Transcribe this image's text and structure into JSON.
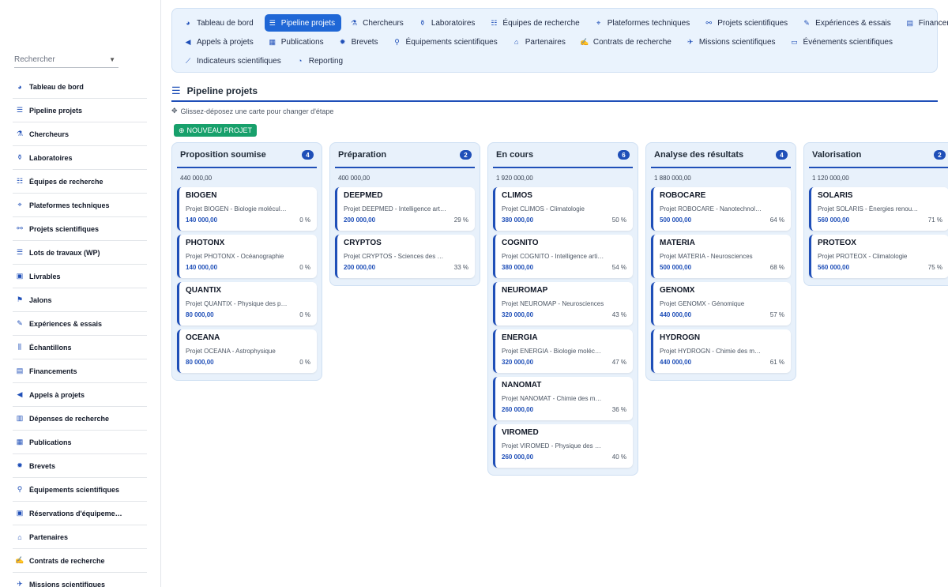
{
  "search": {
    "placeholder": "Rechercher"
  },
  "sidebar": {
    "items": [
      {
        "label": "Tableau de bord",
        "icon": "dashboard-icon",
        "glyph": "◕"
      },
      {
        "label": "Pipeline projets",
        "icon": "list-icon",
        "glyph": "☰"
      },
      {
        "label": "Chercheurs",
        "icon": "researcher-icon",
        "glyph": "⚗"
      },
      {
        "label": "Laboratoires",
        "icon": "flask-icon",
        "glyph": "⚱"
      },
      {
        "label": "Équipes de recherche",
        "icon": "users-icon",
        "glyph": "☷"
      },
      {
        "label": "Plateformes techniques",
        "icon": "satellite-icon",
        "glyph": "⌖"
      },
      {
        "label": "Projets scientifiques",
        "icon": "project-diagram-icon",
        "glyph": "⚯"
      },
      {
        "label": "Lots de travaux (WP)",
        "icon": "tasks-icon",
        "glyph": "☰"
      },
      {
        "label": "Livrables",
        "icon": "clipboard-check-icon",
        "glyph": "▣"
      },
      {
        "label": "Jalons",
        "icon": "flag-icon",
        "glyph": "⚑"
      },
      {
        "label": "Expériences & essais",
        "icon": "syringe-icon",
        "glyph": "✎"
      },
      {
        "label": "Échantillons",
        "icon": "vials-icon",
        "glyph": "⫼"
      },
      {
        "label": "Financements",
        "icon": "money-icon",
        "glyph": "▤"
      },
      {
        "label": "Appels à projets",
        "icon": "bullhorn-icon",
        "glyph": "◀"
      },
      {
        "label": "Dépenses de recherche",
        "icon": "receipt-icon",
        "glyph": "▥"
      },
      {
        "label": "Publications",
        "icon": "book-icon",
        "glyph": "▦"
      },
      {
        "label": "Brevets",
        "icon": "certificate-icon",
        "glyph": "✹"
      },
      {
        "label": "Équipements scientifiques",
        "icon": "microscope-icon",
        "glyph": "⚲"
      },
      {
        "label": "Réservations d'équipeme…",
        "icon": "calendar-check-icon",
        "glyph": "▣"
      },
      {
        "label": "Partenaires",
        "icon": "building-icon",
        "glyph": "⌂"
      },
      {
        "label": "Contrats de recherche",
        "icon": "file-contract-icon",
        "glyph": "✍"
      },
      {
        "label": "Missions scientifiques",
        "icon": "plane-icon",
        "glyph": "✈"
      }
    ]
  },
  "topnav": {
    "rows": [
      [
        {
          "label": "Tableau de bord",
          "icon": "dashboard-icon",
          "glyph": "◕",
          "active": false
        },
        {
          "label": "Pipeline projets",
          "icon": "list-icon",
          "glyph": "☰",
          "active": true
        },
        {
          "label": "Chercheurs",
          "icon": "researcher-icon",
          "glyph": "⚗",
          "active": false
        },
        {
          "label": "Laboratoires",
          "icon": "flask-icon",
          "glyph": "⚱",
          "active": false
        },
        {
          "label": "Équipes de recherche",
          "icon": "users-icon",
          "glyph": "☷",
          "active": false
        },
        {
          "label": "Plateformes techniques",
          "icon": "satellite-icon",
          "glyph": "⌖",
          "active": false
        },
        {
          "label": "Projets scientifiques",
          "icon": "project-diagram-icon",
          "glyph": "⚯",
          "active": false
        },
        {
          "label": "Expériences & essais",
          "icon": "syringe-icon",
          "glyph": "✎",
          "active": false
        },
        {
          "label": "Financements",
          "icon": "money-icon",
          "glyph": "▤",
          "active": false
        }
      ],
      [
        {
          "label": "Appels à projets",
          "icon": "bullhorn-icon",
          "glyph": "◀",
          "active": false
        },
        {
          "label": "Publications",
          "icon": "book-icon",
          "glyph": "▦",
          "active": false
        },
        {
          "label": "Brevets",
          "icon": "certificate-icon",
          "glyph": "✹",
          "active": false
        },
        {
          "label": "Équipements scientifiques",
          "icon": "microscope-icon",
          "glyph": "⚲",
          "active": false
        },
        {
          "label": "Partenaires",
          "icon": "building-icon",
          "glyph": "⌂",
          "active": false
        },
        {
          "label": "Contrats de recherche",
          "icon": "file-contract-icon",
          "glyph": "✍",
          "active": false
        },
        {
          "label": "Missions scientifiques",
          "icon": "plane-icon",
          "glyph": "✈",
          "active": false
        },
        {
          "label": "Événements scientifiques",
          "icon": "laptop-icon",
          "glyph": "▭",
          "active": false
        }
      ],
      [
        {
          "label": "Indicateurs scientifiques",
          "icon": "chart-line-icon",
          "glyph": "⟋",
          "active": false
        },
        {
          "label": "Reporting",
          "icon": "pie-chart-icon",
          "glyph": "◔",
          "active": false
        }
      ]
    ]
  },
  "main": {
    "title": "Pipeline projets",
    "hint": "Glissez-déposez une carte pour changer d'étape",
    "new_button": "NOUVEAU PROJET"
  },
  "columns": [
    {
      "title": "Proposition soumise",
      "count": "4",
      "total": "440 000,00",
      "cards": [
        {
          "name": "BIOGEN",
          "desc": "Projet BIOGEN - Biologie moléculaire",
          "amount": "140 000,00",
          "pct": "0 %"
        },
        {
          "name": "PHOTONX",
          "desc": "Projet PHOTONX - Océanographie",
          "amount": "140 000,00",
          "pct": "0 %"
        },
        {
          "name": "QUANTIX",
          "desc": "Projet QUANTIX - Physique des particules",
          "amount": "80 000,00",
          "pct": "0 %"
        },
        {
          "name": "OCEANA",
          "desc": "Projet OCEANA - Astrophysique",
          "amount": "80 000,00",
          "pct": "0 %"
        }
      ]
    },
    {
      "title": "Préparation",
      "count": "2",
      "total": "400 000,00",
      "cards": [
        {
          "name": "DEEPMED",
          "desc": "Projet DEEPMED - Intelligence artificielle",
          "amount": "200 000,00",
          "pct": "29 %"
        },
        {
          "name": "CRYPTOS",
          "desc": "Projet CRYPTOS - Sciences des données",
          "amount": "200 000,00",
          "pct": "33 %"
        }
      ]
    },
    {
      "title": "En cours",
      "count": "6",
      "total": "1 920 000,00",
      "cards": [
        {
          "name": "CLIMOS",
          "desc": "Projet CLIMOS - Climatologie",
          "amount": "380 000,00",
          "pct": "50 %"
        },
        {
          "name": "COGNITO",
          "desc": "Projet COGNITO - Intelligence artificielle",
          "amount": "380 000,00",
          "pct": "54 %"
        },
        {
          "name": "NEUROMAP",
          "desc": "Projet NEUROMAP - Neurosciences",
          "amount": "320 000,00",
          "pct": "43 %"
        },
        {
          "name": "ENERGIA",
          "desc": "Projet ENERGIA - Biologie moléculaire",
          "amount": "320 000,00",
          "pct": "47 %"
        },
        {
          "name": "NANOMAT",
          "desc": "Projet NANOMAT - Chimie des matériaux",
          "amount": "260 000,00",
          "pct": "36 %"
        },
        {
          "name": "VIROMED",
          "desc": "Projet VIROMED - Physique des particules",
          "amount": "260 000,00",
          "pct": "40 %"
        }
      ]
    },
    {
      "title": "Analyse des résultats",
      "count": "4",
      "total": "1 880 000,00",
      "cards": [
        {
          "name": "ROBOCARE",
          "desc": "Projet ROBOCARE - Nanotechnologies",
          "amount": "500 000,00",
          "pct": "64 %"
        },
        {
          "name": "MATERIA",
          "desc": "Projet MATERIA - Neurosciences",
          "amount": "500 000,00",
          "pct": "68 %"
        },
        {
          "name": "GENOMX",
          "desc": "Projet GENOMX - Génomique",
          "amount": "440 000,00",
          "pct": "57 %"
        },
        {
          "name": "HYDROGN",
          "desc": "Projet HYDROGN - Chimie des matériaux",
          "amount": "440 000,00",
          "pct": "61 %"
        }
      ]
    },
    {
      "title": "Valorisation",
      "count": "2",
      "total": "1 120 000,00",
      "cards": [
        {
          "name": "SOLARIS",
          "desc": "Projet SOLARIS - Énergies renouvelables",
          "amount": "560 000,00",
          "pct": "71 %"
        },
        {
          "name": "PROTEOX",
          "desc": "Projet PROTEOX - Climatologie",
          "amount": "560 000,00",
          "pct": "75 %"
        }
      ]
    }
  ],
  "colors": {
    "accent": "#1f67d6",
    "primary": "#1f4fb8",
    "success": "#17a06b",
    "panel": "#e8f1fb"
  }
}
